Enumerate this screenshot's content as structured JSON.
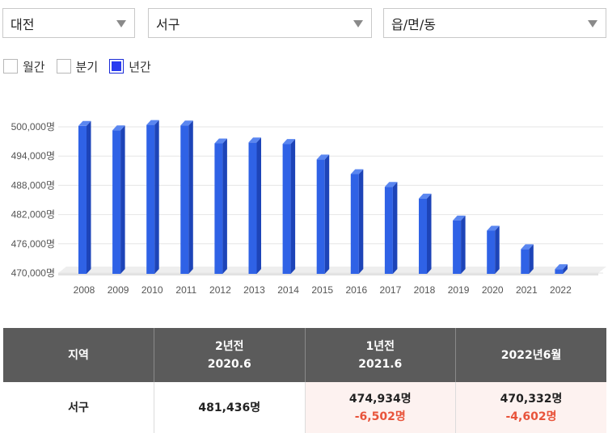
{
  "filters": {
    "city": "대전",
    "district": "서구",
    "dong": "읍/면/동"
  },
  "periods": [
    {
      "label": "월간",
      "checked": false
    },
    {
      "label": "분기",
      "checked": false
    },
    {
      "label": "년간",
      "checked": true
    }
  ],
  "colors": {
    "bar_front": "#2f62e6",
    "bar_side": "#1d44b8",
    "bar_top": "#5a86f0",
    "floor": "#eeeeee",
    "delta": "#e8533a"
  },
  "chart_data": {
    "type": "bar",
    "categories": [
      "2008",
      "2009",
      "2010",
      "2011",
      "2012",
      "2013",
      "2014",
      "2015",
      "2016",
      "2017",
      "2018",
      "2019",
      "2020",
      "2021",
      "2022"
    ],
    "values": [
      500200,
      499300,
      500400,
      500300,
      496600,
      496800,
      496500,
      493300,
      490300,
      487700,
      485300,
      480800,
      478700,
      474900,
      470800
    ],
    "ylim": [
      470000,
      500000
    ],
    "yticks": [
      470000,
      476000,
      482000,
      488000,
      494000,
      500000
    ],
    "ytick_labels": [
      "470,000명",
      "476,000명",
      "482,000명",
      "488,000명",
      "494,000명",
      "500,000명"
    ],
    "grid": true,
    "style": "3d"
  },
  "table": {
    "headers": [
      {
        "line1": "지역",
        "line2": ""
      },
      {
        "line1": "2년전",
        "line2": "2020.6"
      },
      {
        "line1": "1년전",
        "line2": "2021.6"
      },
      {
        "line1": "2022년6월",
        "line2": ""
      }
    ],
    "row": {
      "region": "서구",
      "two_years_ago": "481,436명",
      "one_year_ago": "474,934명",
      "one_year_ago_delta": "-6,502명",
      "current": "470,332명",
      "current_delta": "-4,602명"
    }
  }
}
